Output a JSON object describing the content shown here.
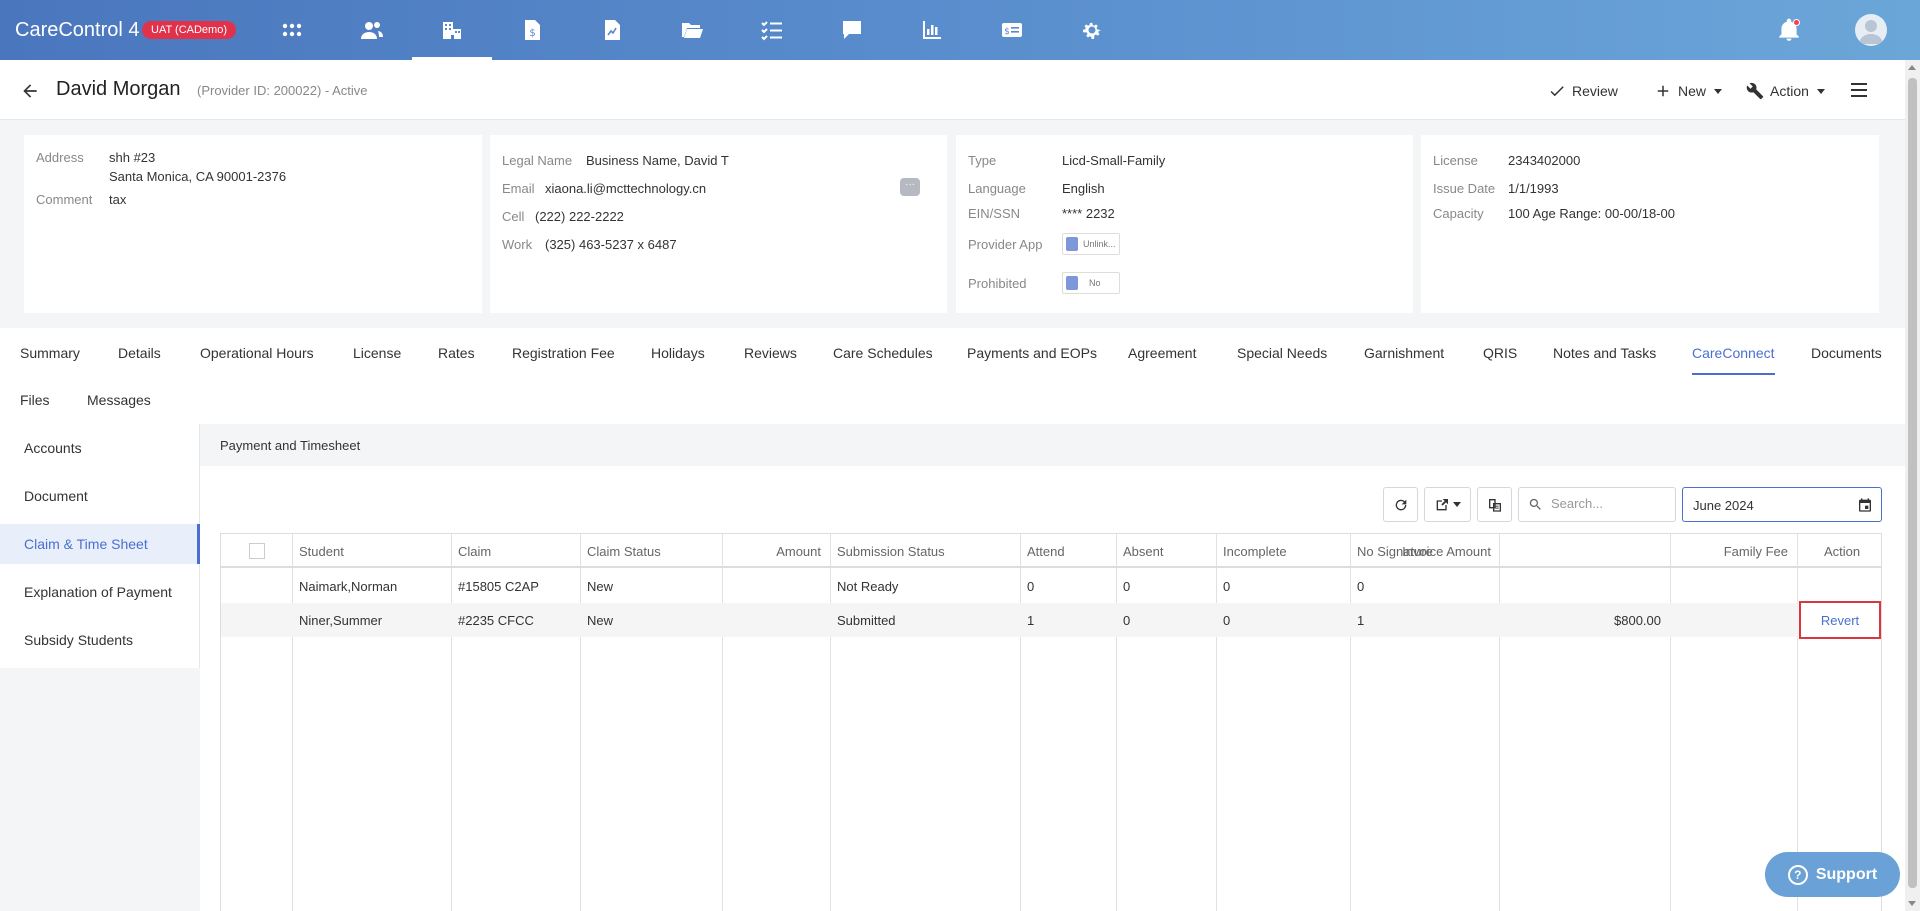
{
  "app": {
    "title": "CareControl 4",
    "env_badge": "UAT (CADemo)"
  },
  "topnav": {
    "icons": [
      "apps-grid-icon",
      "people-icon",
      "provider-building-icon",
      "invoice-dollar-icon",
      "chart-document-icon",
      "folder-open-icon",
      "checklist-icon",
      "chat-bubble-icon",
      "bar-chart-icon",
      "card-dollar-icon",
      "gear-icon"
    ],
    "active": "provider-building-icon"
  },
  "header": {
    "provider_name": "David Morgan",
    "provider_meta": "(Provider ID: 200022) - Active",
    "review_label": "Review",
    "new_label": "New",
    "action_label": "Action"
  },
  "cards": {
    "address": {
      "address_label": "Address",
      "address_line1": "shh #23",
      "address_line2": "Santa Monica, CA 90001-2376",
      "comment_label": "Comment",
      "comment_value": "tax"
    },
    "contact": {
      "legal_name_label": "Legal Name",
      "legal_name_value": "Business Name, David T",
      "email_label": "Email",
      "email_value": "xiaona.li@mcttechnology.cn",
      "cell_label": "Cell",
      "cell_value": "(222) 222-2222",
      "work_label": "Work",
      "work_value": "(325) 463-5237 x 6487",
      "more_label": "···"
    },
    "type": {
      "type_label": "Type",
      "type_value": "Licd-Small-Family",
      "language_label": "Language",
      "language_value": "English",
      "ein_label": "EIN/SSN",
      "ein_value": "**** 2232",
      "provider_app_label": "Provider App",
      "provider_app_value": "Unlink...",
      "prohibited_label": "Prohibited",
      "prohibited_value": "No"
    },
    "license": {
      "license_label": "License",
      "license_value": "2343402000",
      "issue_label": "Issue Date",
      "issue_value": "1/1/1993",
      "capacity_label": "Capacity",
      "capacity_value": "100 Age Range: 00-00/18-00"
    }
  },
  "tabs": [
    "Summary",
    "Details",
    "Operational Hours",
    "License",
    "Rates",
    "Registration Fee",
    "Holidays",
    "Reviews",
    "Care Schedules",
    "Payments and EOPs",
    "Agreement",
    "Special Needs",
    "Garnishment",
    "QRIS",
    "Notes and Tasks",
    "CareConnect",
    "Documents",
    "Files",
    "Messages"
  ],
  "active_tab": "CareConnect",
  "sidemenu": {
    "items": [
      "Accounts",
      "Document",
      "Claim & Time Sheet",
      "Explanation of Payment",
      "Subsidy Students"
    ],
    "active": "Claim & Time Sheet"
  },
  "panel": {
    "title": "Payment and Timesheet",
    "search_placeholder": "Search...",
    "date_value": "June 2024"
  },
  "table": {
    "columns": [
      "Student",
      "Claim",
      "Claim Status",
      "Amount",
      "Submission Status",
      "Attend",
      "Absent",
      "Incomplete",
      "No Signature",
      "Invoice Amount",
      "Family Fee",
      "Action"
    ],
    "rows": [
      {
        "student": "Naimark,Norman",
        "claim": "#15805 C2AP",
        "claim_status": "New",
        "amount": "",
        "submission_status": "Not Ready",
        "attend": "0",
        "absent": "0",
        "incomplete": "0",
        "no_signature": "0",
        "invoice_amount": "",
        "family_fee": "",
        "action": ""
      },
      {
        "student": "Niner,Summer",
        "claim": "#2235 CFCC",
        "claim_status": "New",
        "amount": "",
        "submission_status": "Submitted",
        "attend": "1",
        "absent": "0",
        "incomplete": "0",
        "no_signature": "1",
        "invoice_amount": "$800.00",
        "family_fee": "",
        "action": "Revert"
      }
    ]
  },
  "support": {
    "label": "Support",
    "q": "?"
  },
  "colors": {
    "accent": "#4a6fd0",
    "badge": "#e0324b",
    "highlight": "#d9363e"
  }
}
